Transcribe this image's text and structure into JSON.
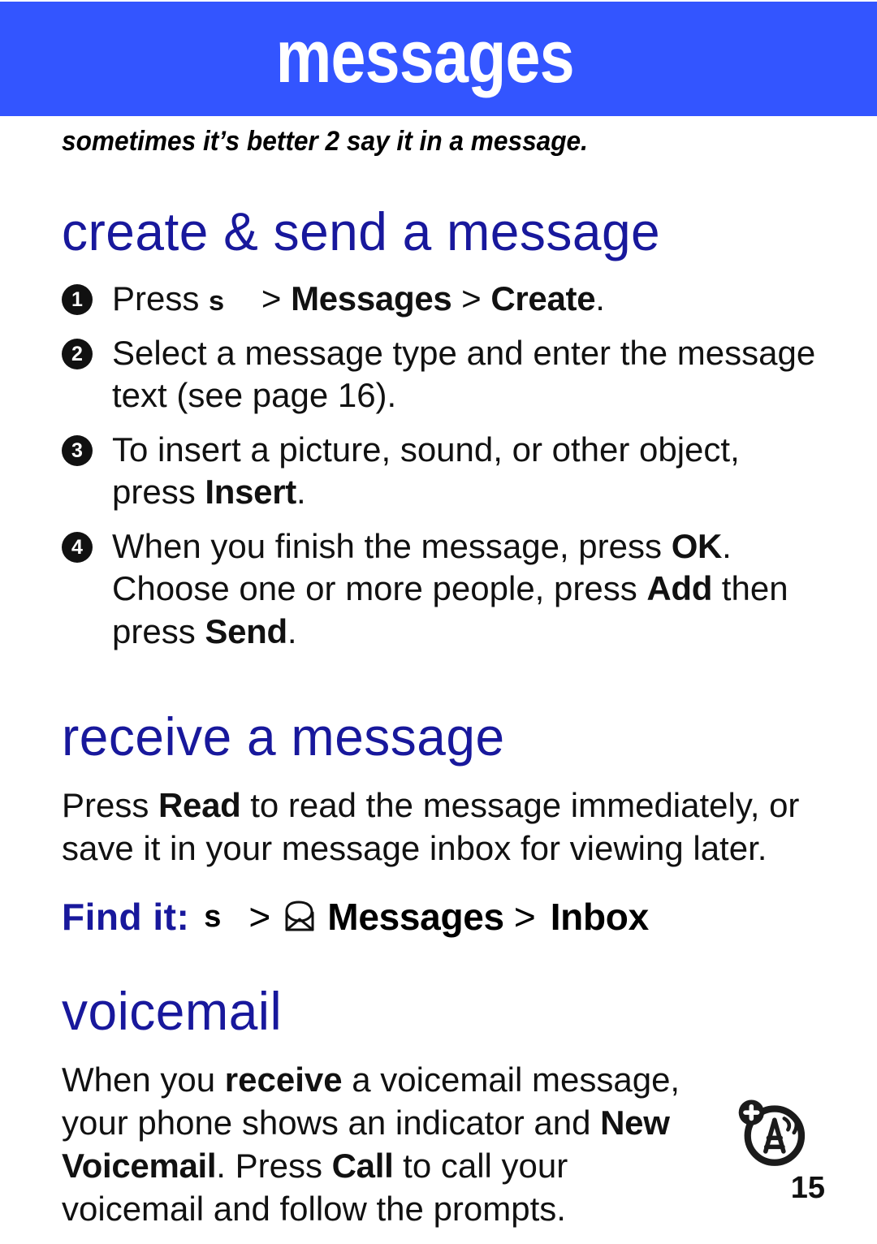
{
  "header": {
    "title": "messages",
    "banner_color": "#3355FF",
    "title_color": "#FFFFFF"
  },
  "subtitle": "sometimes it’s better 2 say it in a message.",
  "accent_color": "#18189C",
  "sections": [
    {
      "heading": "create & send a message",
      "steps": [
        {
          "number": "1",
          "parts": [
            {
              "text": "Press ",
              "style": "plain"
            },
            {
              "text": "s",
              "style": "center-key"
            },
            {
              "text": " > ",
              "style": "plain"
            },
            {
              "text": "Messages",
              "style": "key"
            },
            {
              "text": " > ",
              "style": "plain"
            },
            {
              "text": "Create",
              "style": "key"
            },
            {
              "text": ".",
              "style": "plain"
            }
          ]
        },
        {
          "number": "2",
          "parts": [
            {
              "text": "Select a message type and enter the message text (see page 16).",
              "style": "plain"
            }
          ]
        },
        {
          "number": "3",
          "parts": [
            {
              "text": "To insert a picture, sound, or other object, press ",
              "style": "plain"
            },
            {
              "text": "Insert",
              "style": "key"
            },
            {
              "text": ".",
              "style": "plain"
            }
          ]
        },
        {
          "number": "4",
          "parts": [
            {
              "text": "When you finish the message, press ",
              "style": "plain"
            },
            {
              "text": "OK",
              "style": "key"
            },
            {
              "text": ". Choose one or more people, press ",
              "style": "plain"
            },
            {
              "text": "Add",
              "style": "key"
            },
            {
              "text": " then press ",
              "style": "plain"
            },
            {
              "text": "Send",
              "style": "key"
            },
            {
              "text": ".",
              "style": "plain"
            }
          ]
        }
      ]
    },
    {
      "heading": "receive a message",
      "paragraph": [
        {
          "text": "Press ",
          "style": "plain"
        },
        {
          "text": "Read",
          "style": "key"
        },
        {
          "text": " to read the message immediately, or save it in your message inbox for viewing later.",
          "style": "plain"
        }
      ],
      "find_it": {
        "label": "Find it:",
        "center_key": "s",
        "chevron_1": ">",
        "icon": "open-envelope-icon",
        "item_1": "Messages",
        "chevron_2": ">",
        "item_2": "Inbox"
      }
    },
    {
      "heading": "voicemail",
      "paragraph": [
        {
          "text": "When you ",
          "style": "plain"
        },
        {
          "text": "receive",
          "style": "bold-wide"
        },
        {
          "text": " a voicemail message, your phone shows an indicator and ",
          "style": "plain"
        },
        {
          "text": "New Voicemail",
          "style": "key"
        },
        {
          "text": ". Press ",
          "style": "plain"
        },
        {
          "text": "Call",
          "style": "key"
        },
        {
          "text": " to call your voicemail and follow the prompts.",
          "style": "plain"
        }
      ],
      "icon": "voicemail-indicator-icon"
    }
  ],
  "footer": {
    "page_number": "15"
  }
}
